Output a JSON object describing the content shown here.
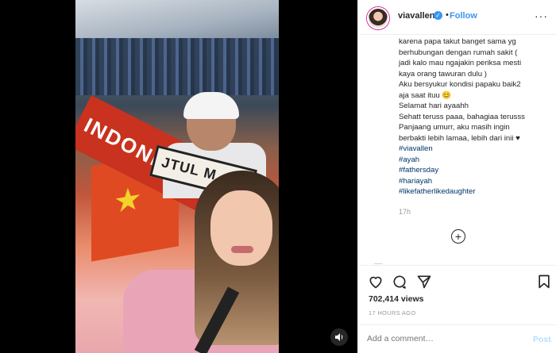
{
  "header": {
    "username": "viavallen",
    "verified_glyph": "✓",
    "separator": "•",
    "follow_label": "Follow",
    "more_label": "···"
  },
  "caption": {
    "lines": [
      "karena papa takut banget sama yg",
      "berhubungan dengan rumah sakit (",
      "jadi kalo mau ngajakin periksa mesti",
      "kaya orang tawuran dulu )",
      "Aku bersyukur kondisi papaku baik2",
      "aja saat ituu 😊",
      "Selamat hari ayaahh",
      "Sehatt teruss paaa, bahagiaa terusss",
      "Panjaang umurr, aku masih ingin",
      "berbakti lebih lamaa, lebih dari inii ♥"
    ],
    "hashtags": [
      "#viavallen",
      "#ayah",
      "#fathersday",
      "#hariayah",
      "#likefatherlikedaughter"
    ],
    "time": "17h"
  },
  "load_more_label": "+",
  "stats": {
    "views": "702,414 views",
    "posted": "17 HOURS AGO"
  },
  "comment": {
    "placeholder": "Add a comment…",
    "post_label": "Post"
  },
  "media": {
    "scarf_text": "INDONE",
    "banner_text": "JTUL M",
    "sound_icon": "sound-icon"
  },
  "colors": {
    "follow": "#3897f0",
    "hashtag": "#003569",
    "post_disabled": "#b2dffc"
  }
}
